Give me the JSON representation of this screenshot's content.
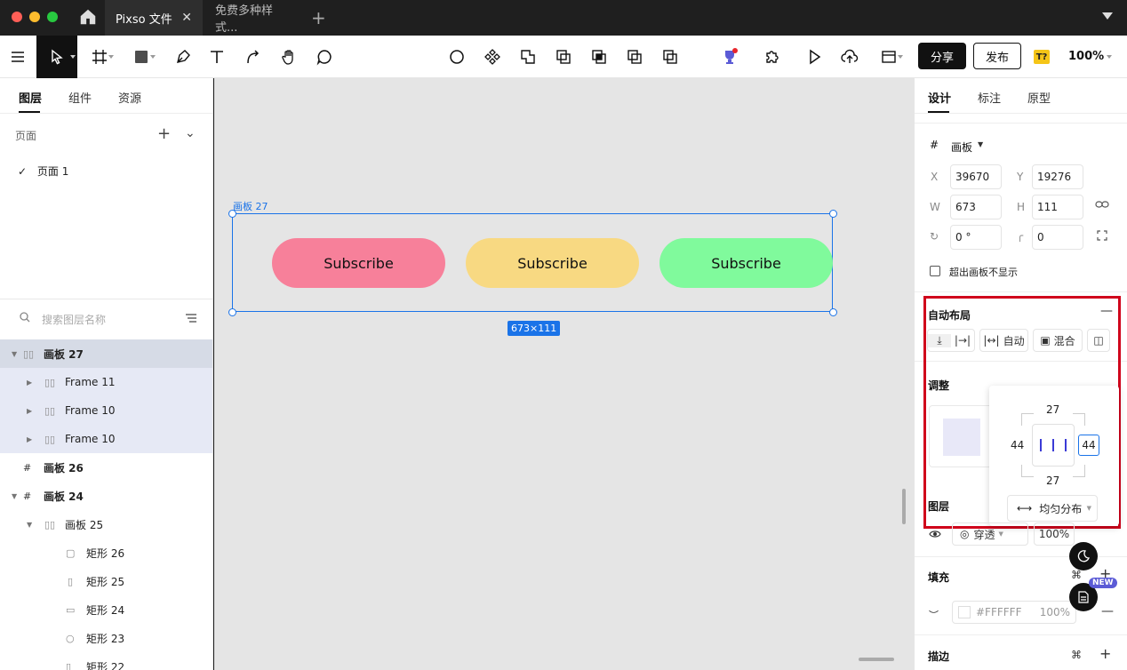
{
  "titlebar": {
    "tabs": [
      {
        "label": "Pixso 文件"
      },
      {
        "label": "免费多种样式..."
      }
    ]
  },
  "toolbar": {
    "share_label": "分享",
    "publish_label": "发布",
    "badge": "T?",
    "zoom": "100%"
  },
  "left": {
    "tabs": [
      "图层",
      "组件",
      "资源"
    ],
    "pages_title": "页面",
    "pages": [
      "页面 1"
    ],
    "search_placeholder": "搜索图层名称",
    "layers": [
      {
        "name": "画板 27"
      },
      {
        "name": "Frame 11"
      },
      {
        "name": "Frame 10"
      },
      {
        "name": "Frame 10"
      },
      {
        "name": "画板 26"
      },
      {
        "name": "画板 24"
      },
      {
        "name": "画板 25"
      },
      {
        "name": "矩形 26"
      },
      {
        "name": "矩形 25"
      },
      {
        "name": "矩形 24"
      },
      {
        "name": "矩形 23"
      },
      {
        "name": "矩形 22"
      }
    ]
  },
  "canvas": {
    "frame_label": "画板 27",
    "size_badge": "673×111",
    "buttons": [
      {
        "label": "Subscribe",
        "color": "#f7809a"
      },
      {
        "label": "Subscribe",
        "color": "#f8d982"
      },
      {
        "label": "Subscribe",
        "color": "#80fa9c"
      }
    ]
  },
  "right": {
    "tabs": [
      "设计",
      "标注",
      "原型"
    ],
    "frame_type": "画板",
    "x_label": "X",
    "x": "39670",
    "y_label": "Y",
    "y": "19276",
    "w_label": "W",
    "w": "673",
    "h_label": "H",
    "h": "111",
    "rotation": "0 °",
    "radius": "0",
    "clip_label": "超出画板不显示",
    "autolayout_title": "自动布局",
    "auto_label": "自动",
    "mix_label": "混合",
    "adjust_title": "调整",
    "padding_top": "27",
    "padding_bottom": "27",
    "padding_left": "44",
    "padding_right": "44",
    "distribute_label": "均匀分布",
    "layer_title": "图层",
    "blend_label": "穿透",
    "opacity": "100%",
    "fill_title": "填充",
    "fill_hex": "#FFFFFF",
    "fill_opacity": "100%",
    "stroke_title": "描边",
    "new_badge": "NEW"
  }
}
